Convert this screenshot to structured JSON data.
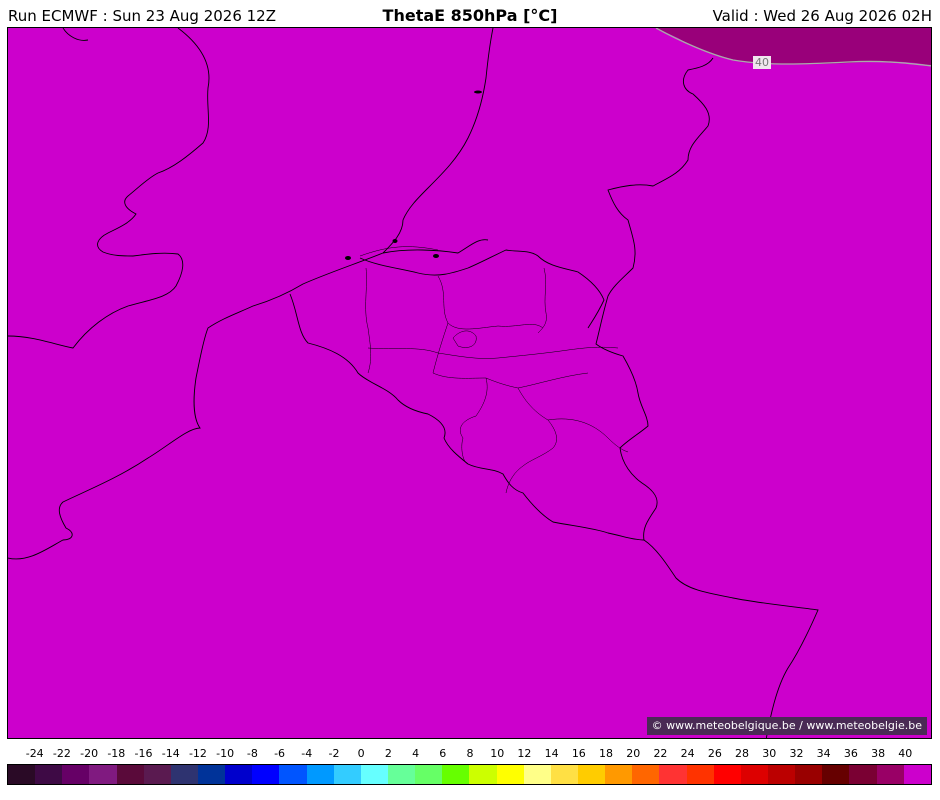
{
  "header": {
    "run": "Run ECMWF : Sun 23 Aug 2026 12Z",
    "title": "ThetaE 850hPa [°C]",
    "valid": "Valid : Wed 26 Aug 2026 02H"
  },
  "map": {
    "fill_color": "#cc00cc",
    "warm_region_color": "#99007a",
    "isoline_label": "40",
    "credit": "© www.meteobelgique.be / www.meteobelgie.be"
  },
  "legend": {
    "labels": [
      "-24",
      "-22",
      "-20",
      "-18",
      "-16",
      "-14",
      "-12",
      "-10",
      "-8",
      "-6",
      "-4",
      "-2",
      "0",
      "2",
      "4",
      "6",
      "8",
      "10",
      "12",
      "14",
      "16",
      "18",
      "20",
      "22",
      "24",
      "26",
      "28",
      "30",
      "32",
      "34",
      "36",
      "38",
      "40"
    ],
    "colors": [
      "#2a0a26",
      "#3e0a45",
      "#660066",
      "#801a80",
      "#5a0a3a",
      "#5a1a50",
      "#2e3370",
      "#003399",
      "#0000cc",
      "#0000ff",
      "#0055ff",
      "#0099ff",
      "#33ccff",
      "#66ffff",
      "#66ff99",
      "#66ff66",
      "#66ff00",
      "#ccff00",
      "#ffff00",
      "#ffff88",
      "#ffe044",
      "#ffcc00",
      "#ff9900",
      "#ff6600",
      "#ff3333",
      "#ff3300",
      "#ff0000",
      "#dd0000",
      "#bb0000",
      "#990000",
      "#660000",
      "#7a0033",
      "#990066",
      "#cc00cc"
    ]
  }
}
